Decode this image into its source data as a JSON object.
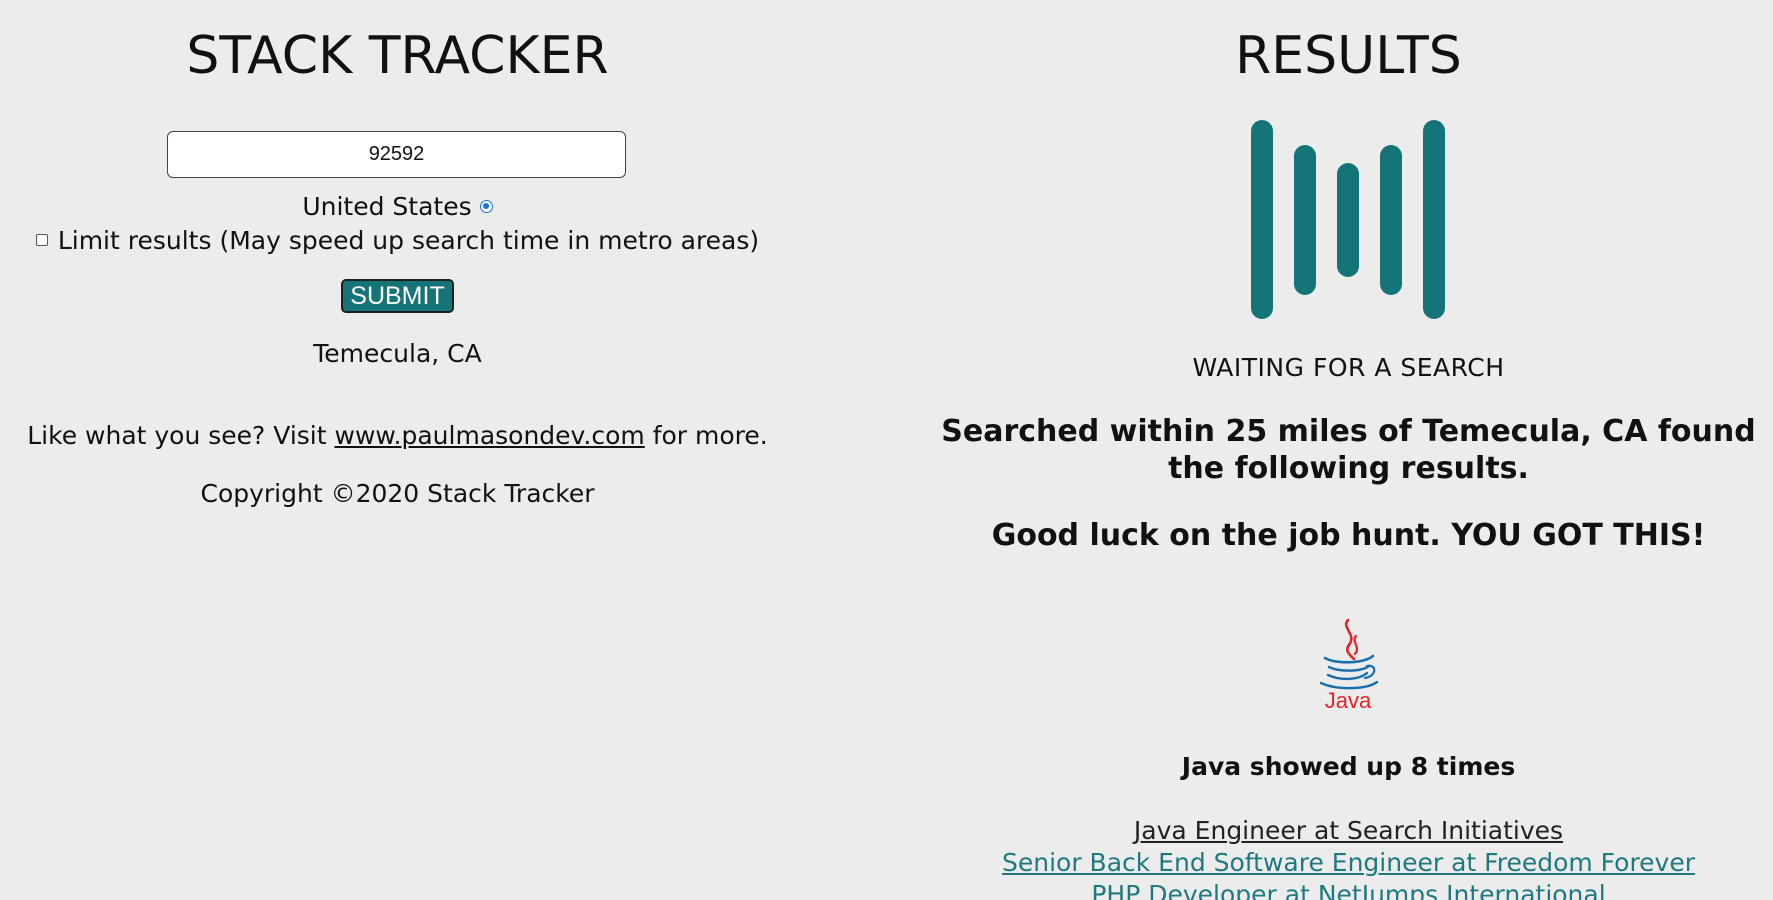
{
  "left": {
    "title": "STACK TRACKER",
    "zip_input": {
      "value": "92592",
      "placeholder": ""
    },
    "country": {
      "label": "United States",
      "selected": true
    },
    "limit": {
      "label": "Limit results (May speed up search time in metro areas)",
      "checked": false
    },
    "submit_label": "SUBMIT",
    "location": "Temecula, CA",
    "promo": {
      "prefix": "Like what you see? Visit ",
      "link_text": "www.paulmasondev.com",
      "suffix": " for more."
    },
    "copyright": "Copyright ©2020 Stack Tracker"
  },
  "right": {
    "title": "RESULTS",
    "loader_icon": "loading-bars-icon",
    "status": "WAITING FOR A SEARCH",
    "summary": "Searched within 25 miles of Temecula, CA found the following results.",
    "encouragement": "Good luck on the job hunt. YOU GOT THIS!",
    "tech_logo": {
      "icon": "java-logo",
      "label": "Java"
    },
    "tech_count": "Java showed up 8 times",
    "jobs": [
      {
        "title": "Java Engineer at Search Initiatives",
        "visited": true
      },
      {
        "title": "Senior Back End Software Engineer at Freedom Forever",
        "visited": false
      },
      {
        "title": "PHP Developer at NetJumps International",
        "visited": false
      }
    ]
  },
  "colors": {
    "background": "#ececec",
    "accent": "#147478",
    "link": "#1f7a7f",
    "java_red": "#e0262a",
    "java_blue": "#1b6fae"
  }
}
